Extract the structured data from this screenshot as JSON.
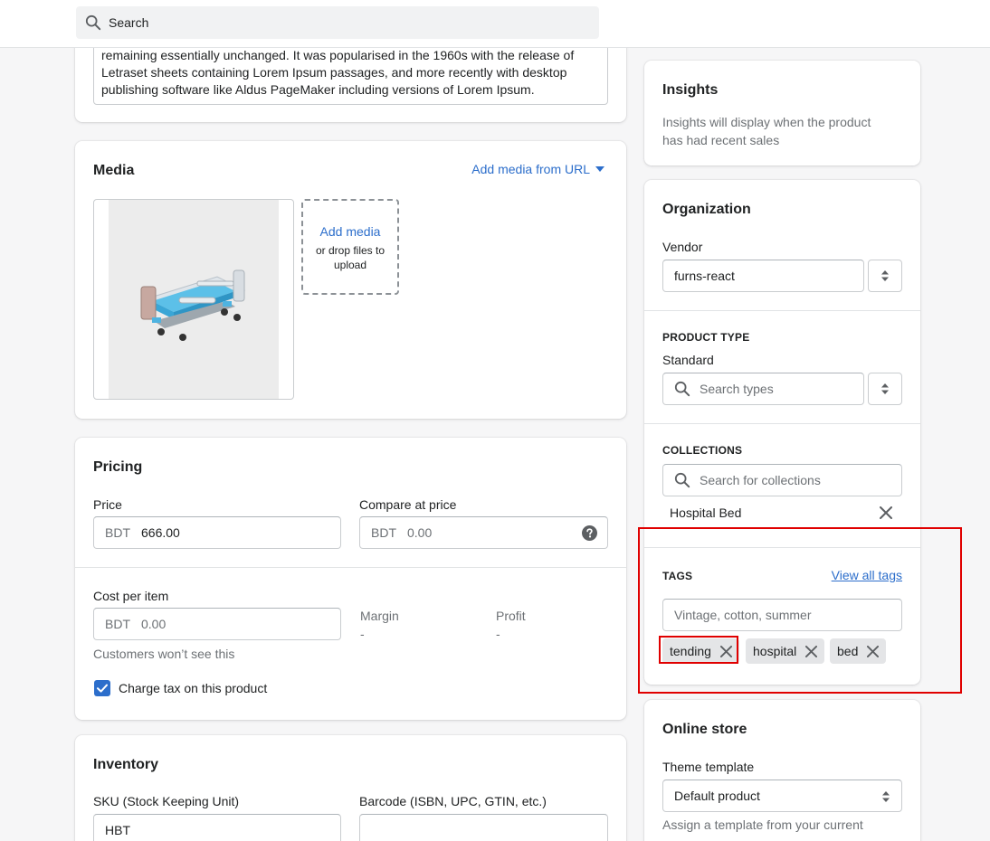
{
  "topbar": {
    "search_placeholder": "Search"
  },
  "description": {
    "lines": [
      "remaining essentially unchanged. It was popularised in the 1960s with the release of",
      "Letraset sheets containing Lorem Ipsum passages, and more recently with desktop",
      "publishing software like Aldus PageMaker including versions of Lorem Ipsum."
    ]
  },
  "media": {
    "title": "Media",
    "add_from_url": "Add media from URL",
    "add_media": "Add media",
    "drop_hint": "or drop files to upload"
  },
  "pricing": {
    "title": "Pricing",
    "price_label": "Price",
    "currency": "BDT",
    "price_value": "666.00",
    "compare_label": "Compare at price",
    "compare_value": "0.00",
    "cost_label": "Cost per item",
    "cost_value": "0.00",
    "cost_hint": "Customers won’t see this",
    "margin_label": "Margin",
    "margin_value": "-",
    "profit_label": "Profit",
    "profit_value": "-",
    "charge_tax": "Charge tax on this product"
  },
  "inventory": {
    "title": "Inventory",
    "sku_label": "SKU (Stock Keeping Unit)",
    "sku_value": "HBT",
    "barcode_label": "Barcode (ISBN, UPC, GTIN, etc.)"
  },
  "insights": {
    "title": "Insights",
    "line1": "Insights will display when the product",
    "line2": "has had recent sales"
  },
  "organization": {
    "title": "Organization",
    "vendor_label": "Vendor",
    "vendor_value": "furns-react",
    "product_type_caps": "PRODUCT TYPE",
    "product_type_value": "Standard",
    "search_types": "Search types",
    "collections_caps": "COLLECTIONS",
    "search_collections": "Search for collections",
    "collection_item": "Hospital Bed",
    "tags_caps": "TAGS",
    "view_all_tags": "View all tags",
    "tags_placeholder": "Vintage, cotton, summer",
    "tags": [
      "tending",
      "hospital",
      "bed"
    ]
  },
  "online_store": {
    "title": "Online store",
    "theme_label": "Theme template",
    "theme_value": "Default product",
    "hint": "Assign a template from your current"
  },
  "colors": {
    "accent": "#2c6ecb",
    "highlight": "#e00000",
    "checkbox": "#2c6ecb"
  }
}
